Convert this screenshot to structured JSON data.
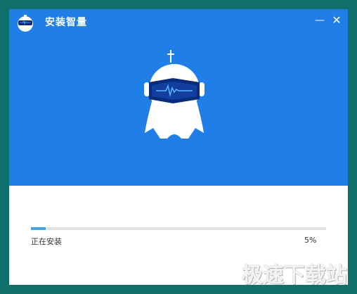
{
  "window": {
    "title": "安装智量",
    "minimize_glyph": "—",
    "close_glyph": "✕"
  },
  "install": {
    "status": "正在安装",
    "percent_text": "5%",
    "progress_fraction": 0.05
  },
  "watermark": {
    "text": "极速下载站"
  },
  "icons": {
    "app_logo": "robot-logo-icon",
    "mascot": "robot-mascot-icon"
  },
  "colors": {
    "header_blue": "#1f7ee8",
    "progress_fill": "#4aa2e6",
    "progress_track": "#e3e3e3",
    "desktop_bg": "#0f6f6a",
    "visor_dark": "#0a2a7a"
  }
}
